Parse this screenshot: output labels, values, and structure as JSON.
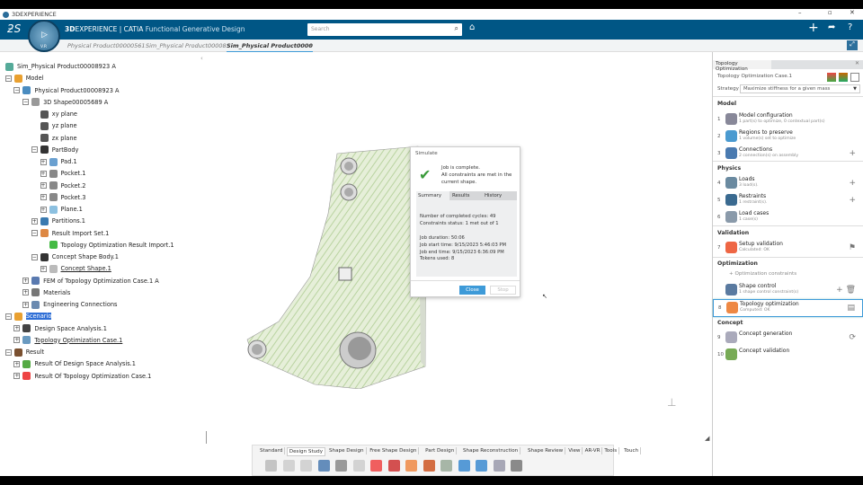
{
  "window": {
    "title": "3DEXPERIENCE"
  },
  "header": {
    "brand_bold": "3D",
    "brand_rest": "EXPERIENCE | CATIA",
    "app": "Functional Generative Design",
    "compass_label": "V.R",
    "search_placeholder": "Search"
  },
  "doc_tabs": [
    {
      "label": "Physical Product00000561"
    },
    {
      "label": "Sim_Physical Product00008"
    },
    {
      "label": "Sim_Physical Product0000",
      "active": true
    },
    {
      "label": "+"
    }
  ],
  "tree": [
    {
      "label": "Sim_Physical Product00008923 A",
      "level": 0,
      "exp": ""
    },
    {
      "label": "Model",
      "level": 1,
      "exp": "-"
    },
    {
      "label": "Physical Product00008923 A",
      "level": 2,
      "exp": "-"
    },
    {
      "label": "3D Shape00005689 A",
      "level": 3,
      "exp": "-"
    },
    {
      "label": "xy plane",
      "level": 4,
      "exp": ""
    },
    {
      "label": "yz plane",
      "level": 4,
      "exp": ""
    },
    {
      "label": "zx plane",
      "level": 4,
      "exp": ""
    },
    {
      "label": "PartBody",
      "level": 4,
      "exp": "-"
    },
    {
      "label": "Pad.1",
      "level": 5,
      "exp": "+"
    },
    {
      "label": "Pocket.1",
      "level": 5,
      "exp": "+"
    },
    {
      "label": "Pocket.2",
      "level": 5,
      "exp": "+"
    },
    {
      "label": "Pocket.3",
      "level": 5,
      "exp": "+"
    },
    {
      "label": "Plane.1",
      "level": 5,
      "exp": "+"
    },
    {
      "label": "Partitions.1",
      "level": 4,
      "exp": "+"
    },
    {
      "label": "Result Import Set.1",
      "level": 4,
      "exp": "-"
    },
    {
      "label": "Topology Optimization Result Import.1",
      "level": 5,
      "exp": ""
    },
    {
      "label": "Concept Shape Body.1",
      "level": 4,
      "exp": "-"
    },
    {
      "label": "Concept Shape.1",
      "level": 5,
      "exp": "+",
      "underline": true
    },
    {
      "label": "FEM of Topology Optimization Case.1 A",
      "level": 3,
      "exp": "+"
    },
    {
      "label": "Materials",
      "level": 3,
      "exp": "+"
    },
    {
      "label": "Engineering Connections",
      "level": 3,
      "exp": "+"
    },
    {
      "label": "Scenario",
      "level": 1,
      "exp": "-",
      "selected": true
    },
    {
      "label": "Design Space Analysis.1",
      "level": 2,
      "exp": "+"
    },
    {
      "label": "Topology Optimization Case.1",
      "level": 2,
      "exp": "+",
      "underline": true
    },
    {
      "label": "Result",
      "level": 1,
      "exp": "-"
    },
    {
      "label": "Result Of Design Space Analysis.1",
      "level": 2,
      "exp": "+"
    },
    {
      "label": "Result Of Topology Optimization Case.1",
      "level": 2,
      "exp": "+"
    }
  ],
  "dialog": {
    "title": "Simulate",
    "msg1": "Job is complete.",
    "msg2": "All constraints are met in the",
    "msg3": "current shape.",
    "tabs": [
      "Summary",
      "Results",
      "History"
    ],
    "lines": [
      "Number of completed cycles: 49",
      "Constraints status: 1 met out of 1",
      "",
      "Job duration: 50:06",
      "Job start time: 9/15/2023 5:46:03 PM",
      "Job end time: 9/15/2023 6:36:09 PM",
      "Tokens used: 8"
    ],
    "close": "Close",
    "stop": "Stop"
  },
  "panel": {
    "tab": "Topology Optimization",
    "case": "Topology Optimization Case.1",
    "strategy_label": "Strategy",
    "strategy_value": "Maximize stiffness for a given mass",
    "sections": {
      "model": "Model",
      "physics": "Physics",
      "validation": "Validation",
      "optimization": "Optimization",
      "concept": "Concept"
    },
    "steps": [
      {
        "num": "1",
        "title": "Model configuration",
        "sub": "1 part(s) to optimize, 0 contextual part(s)"
      },
      {
        "num": "2",
        "title": "Regions to preserve",
        "sub": "1 volume(s) set to optimize"
      },
      {
        "num": "3",
        "title": "Connections",
        "sub": "2 connection(s) on assembly"
      },
      {
        "num": "4",
        "title": "Loads",
        "sub": "3 load(s)."
      },
      {
        "num": "5",
        "title": "Restraints",
        "sub": "1 restraint(s)."
      },
      {
        "num": "6",
        "title": "Load cases",
        "sub": "1 case(s)"
      },
      {
        "num": "7",
        "title": "Setup validation",
        "sub": "Calculated: OK"
      },
      {
        "num": "",
        "title": "Shape control",
        "sub": "1 shape control constraint(s)"
      },
      {
        "num": "8",
        "title": "Topology optimization",
        "sub": "Computed: OK"
      },
      {
        "num": "9",
        "title": "Concept generation",
        "sub": ""
      },
      {
        "num": "10",
        "title": "Concept validation",
        "sub": ""
      }
    ],
    "opt_constraints": "Optimization constraints"
  },
  "toolbar": {
    "tabs": [
      "Standard",
      "Design Study",
      "Shape Design",
      "Free Shape Design",
      "Part Design",
      "Shape Reconstruction",
      "Shape Review",
      "View",
      "AR-VR",
      "Tools",
      "Touch"
    ],
    "active": "Design Study"
  },
  "colors": {
    "header": "#005685",
    "accent": "#3d9ad8",
    "selection": "#2f6fd6"
  }
}
